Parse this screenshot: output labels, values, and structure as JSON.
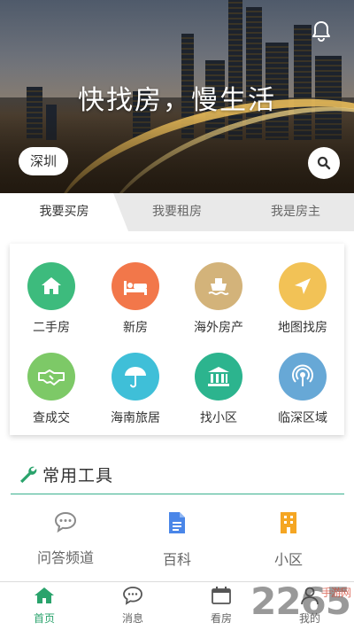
{
  "hero": {
    "slogan": "快找房，慢生活",
    "city": "深圳"
  },
  "tabs": [
    {
      "label": "我要买房",
      "active": true
    },
    {
      "label": "我要租房",
      "active": false
    },
    {
      "label": "我是房主",
      "active": false
    }
  ],
  "grid": [
    {
      "label": "二手房",
      "icon": "home-icon",
      "color": "#3dbb7d"
    },
    {
      "label": "新房",
      "icon": "bed-icon",
      "color": "#f2774a"
    },
    {
      "label": "海外房产",
      "icon": "ship-icon",
      "color": "#d3b37a"
    },
    {
      "label": "地图找房",
      "icon": "navigation-arrow-icon",
      "color": "#f2c256"
    },
    {
      "label": "查成交",
      "icon": "handshake-icon",
      "color": "#7dc967"
    },
    {
      "label": "海南旅居",
      "icon": "umbrella-icon",
      "color": "#3fbfd8"
    },
    {
      "label": "找小区",
      "icon": "building-icon",
      "color": "#2cb48e"
    },
    {
      "label": "临深区域",
      "icon": "broadcast-icon",
      "color": "#67a8d6"
    }
  ],
  "tools": {
    "title": "常用工具",
    "items": [
      {
        "label": "问答频道",
        "icon": "chat-bubble-icon",
        "color": "#8a8a8a"
      },
      {
        "label": "百科",
        "icon": "document-icon",
        "color": "#4a86e8"
      },
      {
        "label": "小区",
        "icon": "apartment-icon",
        "color": "#f5a623"
      }
    ]
  },
  "bottom_nav": [
    {
      "label": "首页",
      "icon": "home-icon",
      "active": true
    },
    {
      "label": "消息",
      "icon": "message-icon",
      "active": false
    },
    {
      "label": "看房",
      "icon": "calendar-icon",
      "active": false
    },
    {
      "label": "我的",
      "icon": "user-icon",
      "active": false
    }
  ],
  "watermark": {
    "text": "2265",
    "sub": "手游网"
  },
  "colors": {
    "accent": "#2aa36c",
    "divider": "#39b08e"
  }
}
